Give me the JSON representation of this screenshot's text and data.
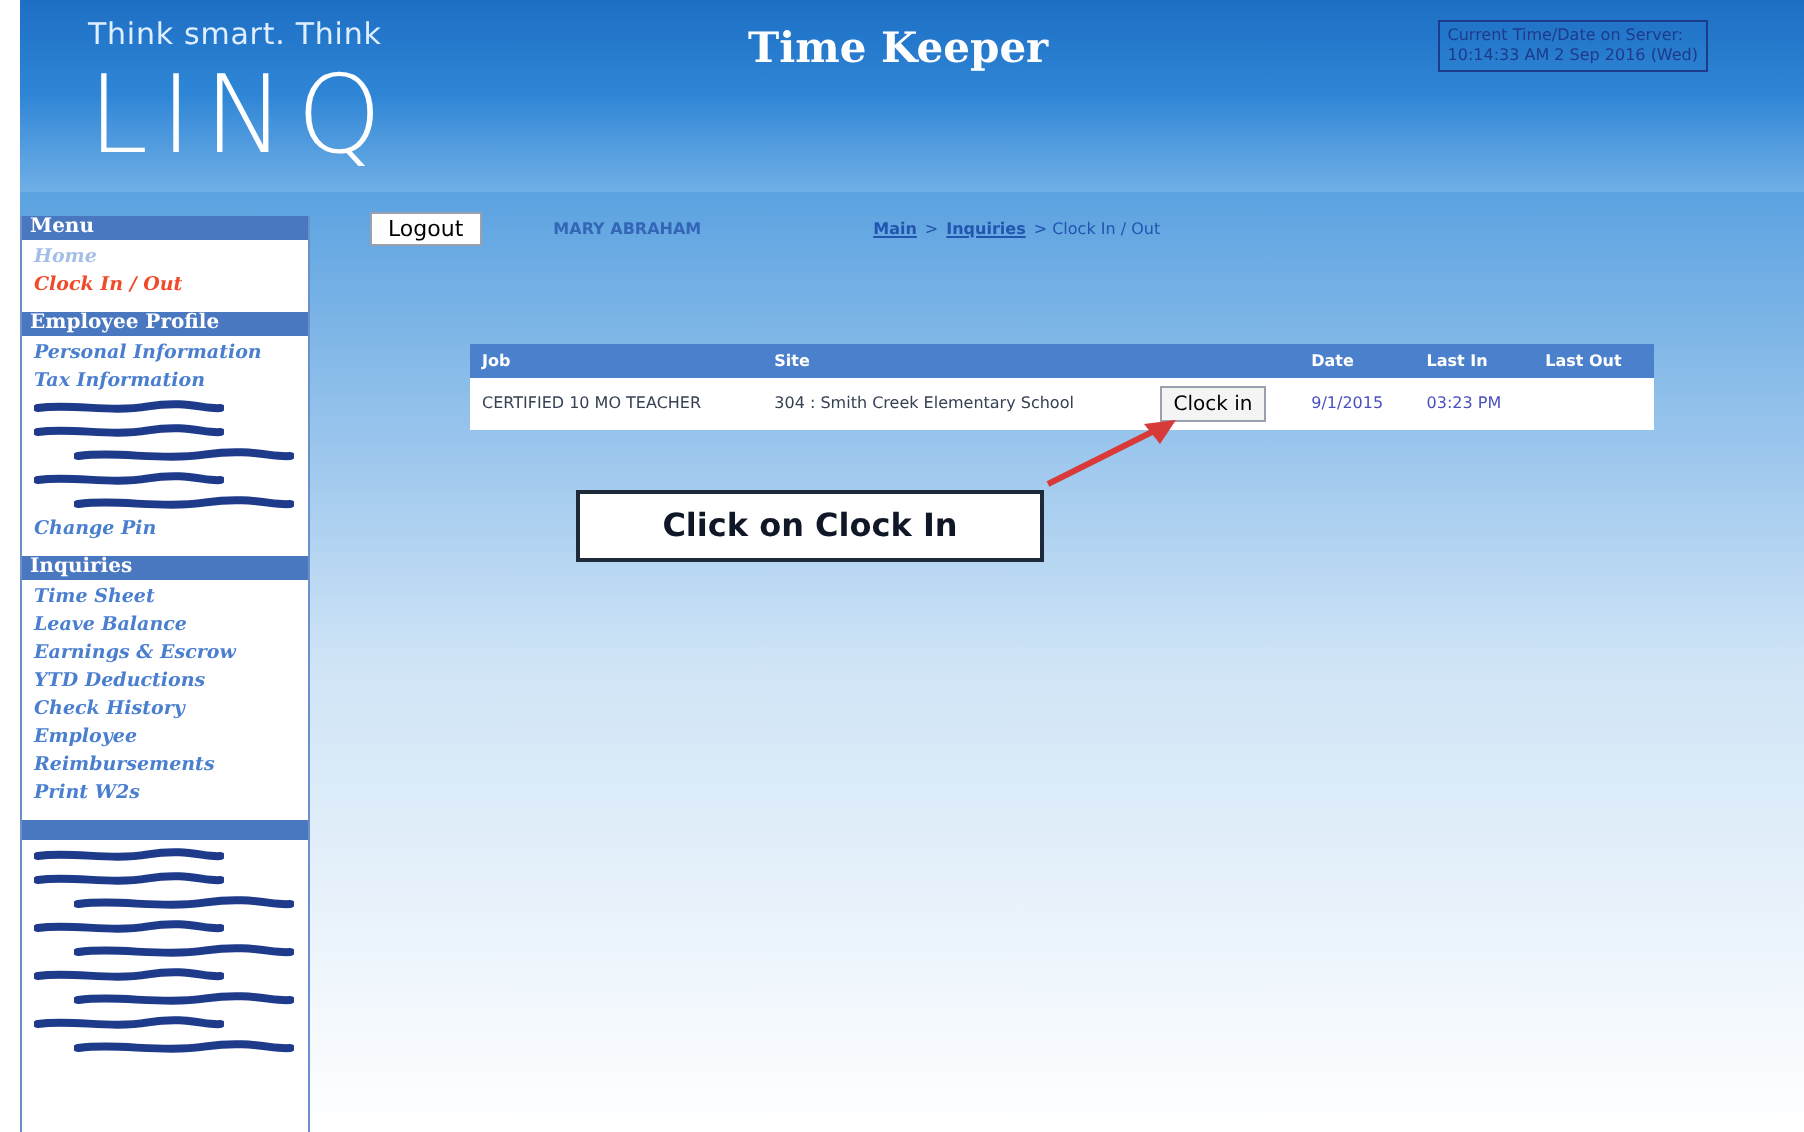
{
  "header": {
    "tagline": "Think smart. Think",
    "logo": "LINQ",
    "title": "Time Keeper",
    "server_time": [
      "Current Time/Date on Server:",
      "10:14:33 AM 2 Sep 2016 (Wed)"
    ]
  },
  "sidebar": [
    {
      "heading": "Menu",
      "items": [
        {
          "kind": "link",
          "label": "Home",
          "selected": false,
          "disabled": true
        },
        {
          "kind": "link",
          "label": "Clock In / Out",
          "selected": true,
          "disabled": false
        }
      ]
    },
    {
      "heading": "Employee Profile",
      "items": [
        {
          "kind": "link",
          "label": "Personal Information",
          "selected": false,
          "disabled": false
        },
        {
          "kind": "link",
          "label": "Tax Information",
          "selected": false,
          "disabled": false
        },
        {
          "kind": "redacted",
          "indent": false
        },
        {
          "kind": "redacted",
          "indent": false
        },
        {
          "kind": "redacted",
          "indent": true
        },
        {
          "kind": "redacted",
          "indent": false
        },
        {
          "kind": "redacted",
          "indent": true
        },
        {
          "kind": "link",
          "label": "Change Pin",
          "selected": false,
          "disabled": false
        }
      ]
    },
    {
      "heading": "Inquiries",
      "items": [
        {
          "kind": "link",
          "label": "Time Sheet",
          "selected": false,
          "disabled": false
        },
        {
          "kind": "link",
          "label": "Leave Balance",
          "selected": false,
          "disabled": false
        },
        {
          "kind": "link",
          "label": "Earnings & Escrow",
          "selected": false,
          "disabled": false
        },
        {
          "kind": "link",
          "label": "YTD Deductions",
          "selected": false,
          "disabled": false
        },
        {
          "kind": "link",
          "label": "Check History",
          "selected": false,
          "disabled": false
        },
        {
          "kind": "link",
          "label": "Employee Reimbursements",
          "selected": false,
          "disabled": false
        },
        {
          "kind": "link",
          "label": "Print W2s",
          "selected": false,
          "disabled": false
        }
      ]
    },
    {
      "items": [
        {
          "kind": "redacted",
          "indent": false
        },
        {
          "kind": "redacted",
          "indent": false
        },
        {
          "kind": "redacted",
          "indent": true
        },
        {
          "kind": "redacted",
          "indent": false
        },
        {
          "kind": "redacted",
          "indent": true
        },
        {
          "kind": "redacted",
          "indent": false
        },
        {
          "kind": "redacted",
          "indent": true
        },
        {
          "kind": "redacted",
          "indent": false
        },
        {
          "kind": "redacted",
          "indent": true
        }
      ]
    }
  ],
  "toolbar": {
    "logout": "Logout",
    "user": "MARY ABRAHAM",
    "breadcrumb": [
      {
        "label": "Main",
        "link": true
      },
      {
        "label": ">",
        "link": false
      },
      {
        "label": "Inquiries",
        "link": true
      },
      {
        "label": "> Clock In / Out",
        "link": false
      }
    ]
  },
  "table": {
    "columns": [
      "Job",
      "Site",
      "",
      "Date",
      "Last In",
      "Last Out"
    ],
    "rows": [
      {
        "job": "CERTIFIED 10 MO TEACHER",
        "site": "304 : Smith Creek Elementary School",
        "button": "Clock in",
        "date": "9/1/2015",
        "last_in": "03:23 PM"
      }
    ]
  },
  "callout": "Click on Clock In"
}
